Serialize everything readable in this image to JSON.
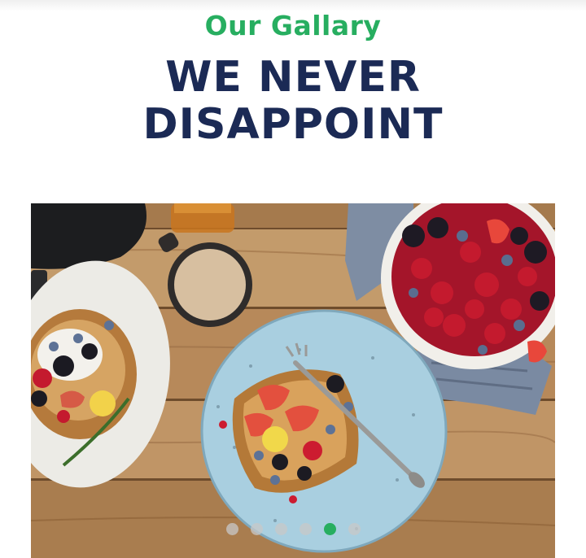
{
  "gallery": {
    "subtitle": "Our Gallary",
    "title_line1": "WE NEVER",
    "title_line2": "DISAPPOINT",
    "slides": [
      {
        "image": "breakfast-table-photo",
        "active": false
      },
      {
        "image": "breakfast-table-photo",
        "active": false
      },
      {
        "image": "breakfast-table-photo",
        "active": false
      },
      {
        "image": "breakfast-table-photo",
        "active": false
      },
      {
        "image": "breakfast-table-photo",
        "active": true
      },
      {
        "image": "breakfast-table-photo",
        "active": false
      }
    ],
    "active_slide": 5
  },
  "colors": {
    "accent": "#27ae60",
    "heading": "#1b2a55"
  }
}
